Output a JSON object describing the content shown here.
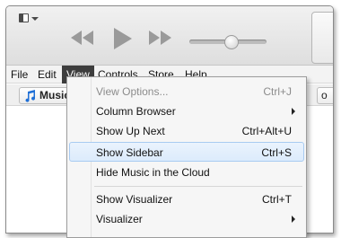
{
  "toolbar": {
    "app_menu_icon": "app-menu-icon",
    "prev_icon": "rewind-icon",
    "play_icon": "play-icon",
    "next_icon": "fast-forward-icon",
    "volume_level": 0.55
  },
  "menubar": {
    "items": [
      {
        "label": "File"
      },
      {
        "label": "Edit"
      },
      {
        "label": "View"
      },
      {
        "label": "Controls"
      },
      {
        "label": "Store"
      },
      {
        "label": "Help"
      }
    ],
    "active": "View"
  },
  "library": {
    "music_label": "Music",
    "right_button_label": "o"
  },
  "view_menu": {
    "items": [
      {
        "label": "View Options...",
        "shortcut": "Ctrl+J",
        "disabled": true
      },
      {
        "label": "Column Browser",
        "shortcut": "",
        "submenu": true
      },
      {
        "label": "Show Up Next",
        "shortcut": "Ctrl+Alt+U"
      },
      {
        "label": "Show Sidebar",
        "shortcut": "Ctrl+S",
        "highlighted": true
      },
      {
        "label": "Hide Music in the Cloud",
        "shortcut": ""
      },
      {
        "label": "Show Visualizer",
        "shortcut": "Ctrl+T"
      },
      {
        "label": "Visualizer",
        "shortcut": "",
        "submenu": true
      }
    ]
  },
  "colors": {
    "active_menu_bg": "#3d3d3d",
    "highlight_bg": "#dcebfc",
    "highlight_border": "#a8cbf1",
    "disabled_text": "#8c8c8c"
  }
}
